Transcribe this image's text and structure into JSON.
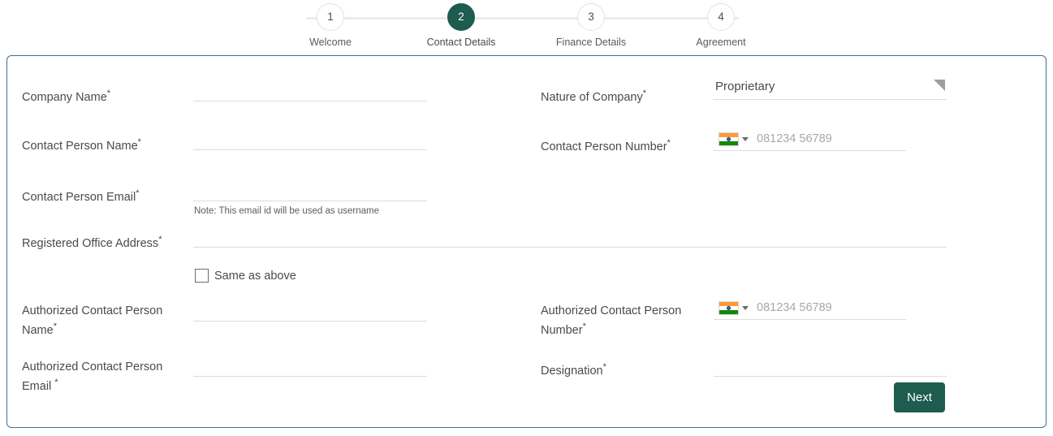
{
  "stepper": {
    "steps": [
      {
        "number": "1",
        "label": "Welcome",
        "active": false
      },
      {
        "number": "2",
        "label": "Contact Details",
        "active": true
      },
      {
        "number": "3",
        "label": "Finance Details",
        "active": false
      },
      {
        "number": "4",
        "label": "Agreement",
        "active": false
      }
    ]
  },
  "form": {
    "company_name": {
      "label": "Company Name",
      "required": "*",
      "value": "",
      "placeholder": ""
    },
    "contact_person_name": {
      "label": "Contact Person Name",
      "required": "*",
      "value": "",
      "placeholder": ""
    },
    "contact_person_email": {
      "label": "Contact Person Email",
      "required": "*",
      "value": "",
      "placeholder": ""
    },
    "email_note": "Note: This email id will be used as username",
    "registered_office_address": {
      "label": "Registered Office Address",
      "required": "*",
      "value": "",
      "placeholder": ""
    },
    "same_as_above": {
      "label": "Same as above",
      "checked": false
    },
    "authorized_contact_person_name": {
      "label": "Authorized Contact Person Name",
      "required": "*",
      "value": "",
      "placeholder": ""
    },
    "authorized_contact_person_email": {
      "label": "Authorized Contact Person Email ",
      "required": "*",
      "value": "",
      "placeholder": ""
    },
    "nature_of_company": {
      "label": "Nature of Company",
      "required": "*",
      "selected": "Proprietary"
    },
    "contact_person_number": {
      "label": "Contact Person Number",
      "required": "*",
      "value": "",
      "placeholder": "081234 56789",
      "country": "India"
    },
    "authorized_contact_person_number": {
      "label": "Authorized Contact Person Number",
      "required": "*",
      "value": "",
      "placeholder": "081234 56789",
      "country": "India"
    },
    "designation": {
      "label": "Designation",
      "required": "*",
      "value": "",
      "placeholder": ""
    }
  },
  "actions": {
    "next_label": "Next"
  },
  "colors": {
    "accent": "#1d5c4f",
    "panel_border": "#3a7296",
    "field_underline": "#dcdcdc",
    "text": "#4a4a4a",
    "placeholder": "#a8a8a8"
  }
}
